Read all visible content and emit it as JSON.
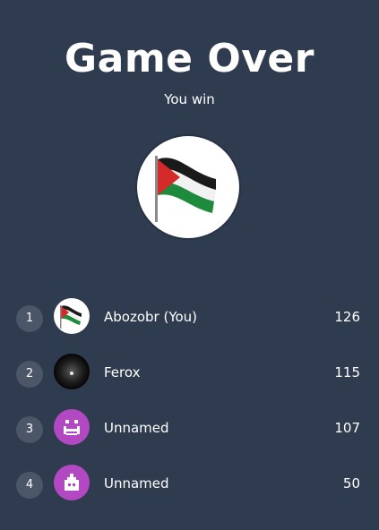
{
  "game_over": {
    "title": "Game Over",
    "subtitle": "You win",
    "winner_avatar_icon": "palestine-flag-icon"
  },
  "leaderboard": [
    {
      "rank": "1",
      "name": "Abozobr (You)",
      "score": "126",
      "avatar_icon": "palestine-flag-icon"
    },
    {
      "rank": "2",
      "name": "Ferox",
      "score": "115",
      "avatar_icon": "dark-sphere-avatar-icon"
    },
    {
      "rank": "3",
      "name": "Unnamed",
      "score": "107",
      "avatar_icon": "pixel-face-avatar-icon"
    },
    {
      "rank": "4",
      "name": "Unnamed",
      "score": "50",
      "avatar_icon": "pixel-robot-avatar-icon"
    }
  ],
  "colors": {
    "background": "#2f3b4e",
    "rank_badge": "#4b5668",
    "unnamed_avatar": "#b349c2"
  }
}
